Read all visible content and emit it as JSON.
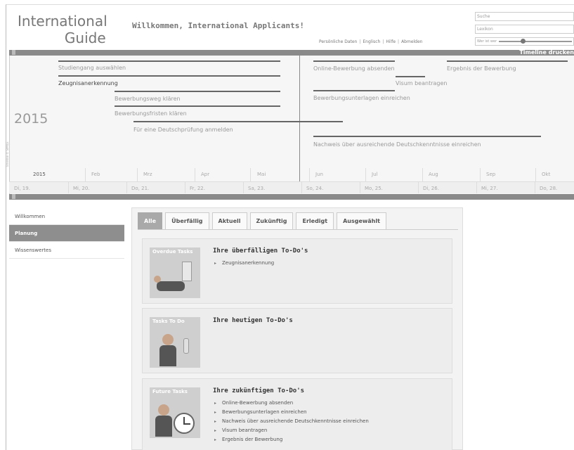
{
  "header": {
    "logo_line1": "International",
    "logo_line2": "Guide",
    "welcome": "Willkommen, International Applicants!",
    "nav": [
      "Persönliche Daten",
      "Englisch",
      "Hilfe",
      "Abmelden"
    ],
    "search_placeholder": "Suche",
    "second_input_placeholder": "Lexikon",
    "zoom_label": "Wer ist wer"
  },
  "timeline": {
    "download_label": "Timeline drucken",
    "year": "2015",
    "side_label": "Timeline © SIMILE",
    "events": [
      "Studiengang auswählen",
      "Zeugnisanerkennung",
      "Bewerbungsweg klären",
      "Bewerbungsfristen klären",
      "Für eine Deutschprüfung anmelden",
      "Online-Bewerbung absenden",
      "Visum beantragen",
      "Bewerbungsunterlagen einreichen",
      "Ergebnis der Bewerbung",
      "Nachweis über ausreichende Deutschkenntnisse einreichen"
    ],
    "months": [
      "2015",
      "Feb",
      "Mrz",
      "Apr",
      "Mai",
      "Jun",
      "Jul",
      "Aug",
      "Sep",
      "Okt"
    ],
    "days": [
      "Di, 19.",
      "Mi, 20.",
      "Do, 21.",
      "Fr, 22.",
      "Sa, 23.",
      "So, 24.",
      "Mo, 25.",
      "Di, 26.",
      "Mi, 27.",
      "Do, 28."
    ]
  },
  "sidebar": {
    "items": [
      {
        "label": "Willkommen",
        "active": false
      },
      {
        "label": "Planung",
        "active": true
      },
      {
        "label": "Wissenswertes",
        "active": false
      }
    ]
  },
  "tabs": [
    {
      "label": "Alle",
      "active": true
    },
    {
      "label": "Überfällig",
      "active": false
    },
    {
      "label": "Aktuell",
      "active": false
    },
    {
      "label": "Zukünftig",
      "active": false
    },
    {
      "label": "Erledigt",
      "active": false
    },
    {
      "label": "Ausgewählt",
      "active": false
    }
  ],
  "cards": [
    {
      "image_caption": "Overdue Tasks",
      "title": "Ihre überfälligen To-Do's",
      "items": [
        "Zeugnisanerkennung"
      ]
    },
    {
      "image_caption": "Tasks To Do",
      "title": "Ihre heutigen To-Do's",
      "items": []
    },
    {
      "image_caption": "Future Tasks",
      "title": "Ihre zukünftigen To-Do's",
      "items": [
        "Online-Bewerbung absenden",
        "Bewerbungsunterlagen einreichen",
        "Nachweis über ausreichende Deutschkenntnisse einreichen",
        "Visum beantragen",
        "Ergebnis der Bewerbung"
      ]
    }
  ]
}
